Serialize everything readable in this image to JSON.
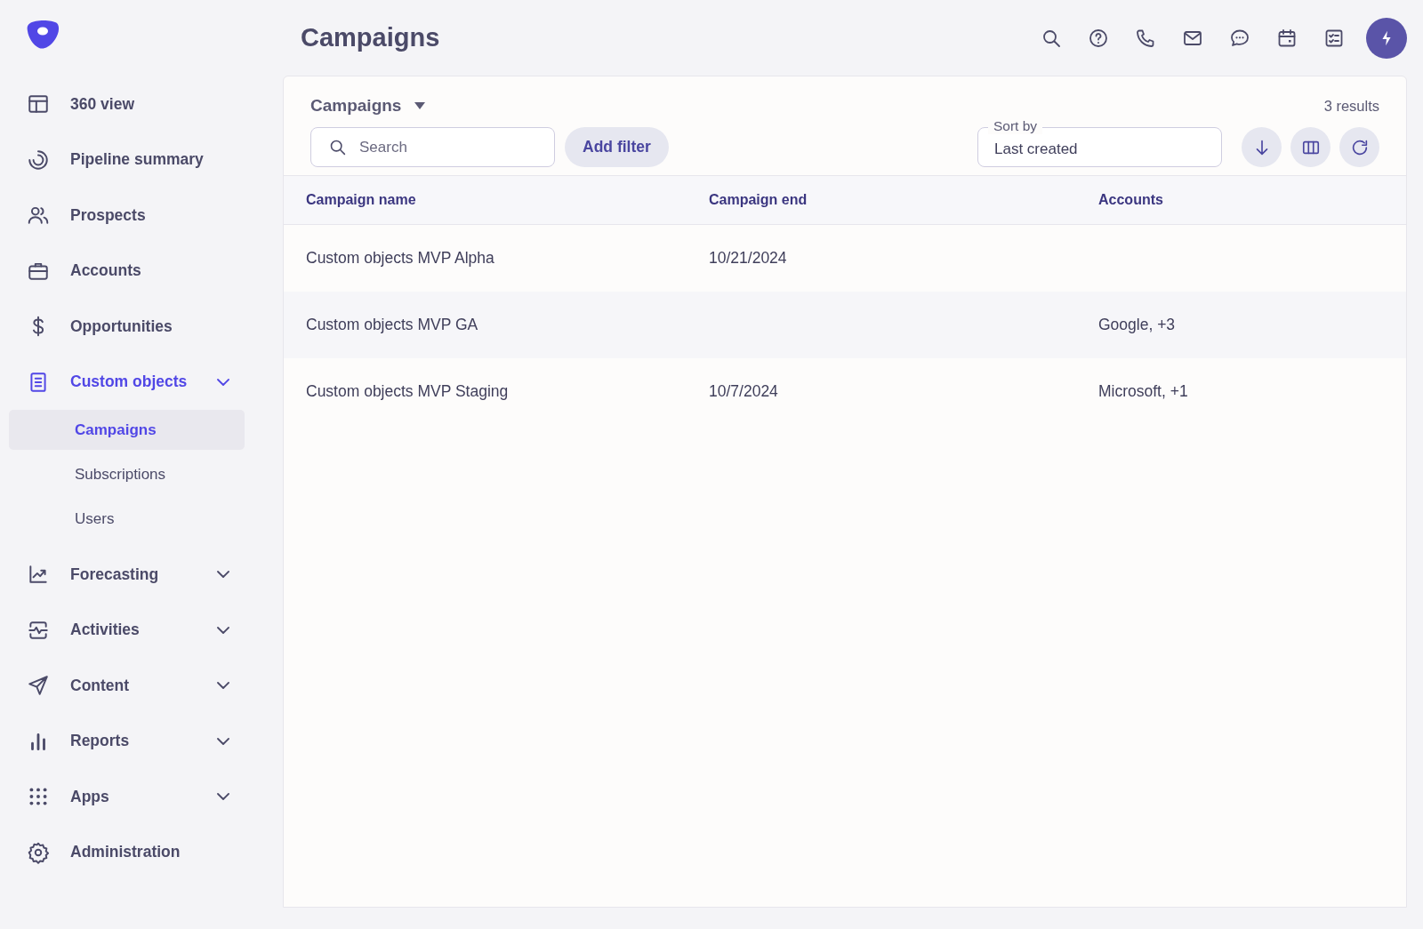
{
  "sidebar": {
    "items": [
      {
        "label": "360 view",
        "active": false,
        "expandable": false
      },
      {
        "label": "Pipeline summary",
        "active": false,
        "expandable": false
      },
      {
        "label": "Prospects",
        "active": false,
        "expandable": false
      },
      {
        "label": "Accounts",
        "active": false,
        "expandable": false
      },
      {
        "label": "Opportunities",
        "active": false,
        "expandable": false
      },
      {
        "label": "Custom objects",
        "active": true,
        "expandable": true,
        "children": [
          {
            "label": "Campaigns",
            "selected": true
          },
          {
            "label": "Subscriptions",
            "selected": false
          },
          {
            "label": "Users",
            "selected": false
          }
        ]
      },
      {
        "label": "Forecasting",
        "active": false,
        "expandable": true
      },
      {
        "label": "Activities",
        "active": false,
        "expandable": true
      },
      {
        "label": "Content",
        "active": false,
        "expandable": true
      },
      {
        "label": "Reports",
        "active": false,
        "expandable": true
      },
      {
        "label": "Apps",
        "active": false,
        "expandable": true
      },
      {
        "label": "Administration",
        "active": false,
        "expandable": false
      }
    ]
  },
  "header": {
    "title": "Campaigns"
  },
  "panel": {
    "view_selector": "Campaigns",
    "result_count": "3 results",
    "search": {
      "placeholder": "Search"
    },
    "add_filter": "Add filter",
    "sort": {
      "label": "Sort by",
      "value": "Last created"
    }
  },
  "table": {
    "columns": [
      "Campaign name",
      "Campaign end",
      "Accounts"
    ],
    "rows": [
      {
        "cells": [
          "Custom objects MVP Alpha",
          "10/21/2024",
          ""
        ]
      },
      {
        "cells": [
          "Custom objects MVP GA",
          "",
          "Google, +3"
        ]
      },
      {
        "cells": [
          "Custom objects MVP Staging",
          "10/7/2024",
          "Microsoft, +1"
        ]
      }
    ]
  }
}
